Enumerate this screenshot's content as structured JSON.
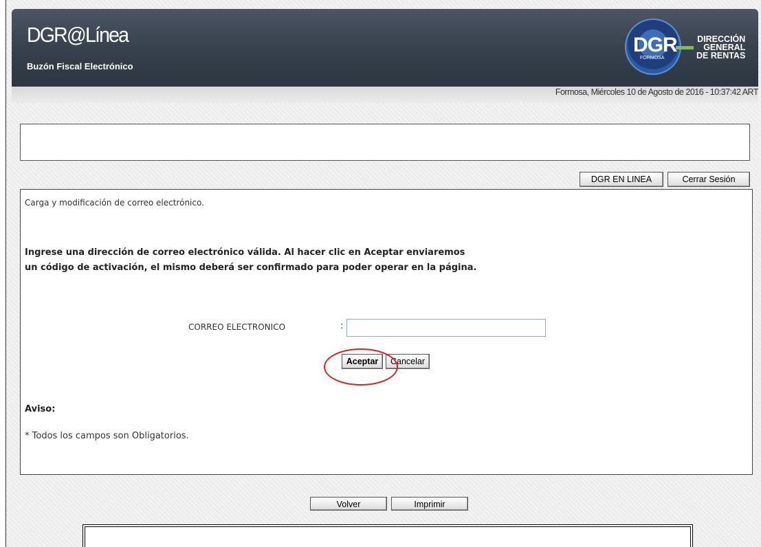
{
  "header": {
    "app_title": "DGR@Línea",
    "subtitle": "Buzón Fiscal Electrónico",
    "logo": {
      "badge": "DGR",
      "region": "FORMOSA",
      "line1": "DIRECCIÓN",
      "line2": "GENERAL",
      "line3": "DE RENTAS"
    }
  },
  "datebar": {
    "text": "Formosa, Miércoles 10 de Agosto de 2016 - 10:37:42 ART"
  },
  "toolbar": {
    "dgr_label": "DGR EN LINEA",
    "logout_label": "Cerrar Sesión"
  },
  "panel": {
    "title": "Carga y modificación de correo electrónico.",
    "instructions_line1": "Ingrese una dirección de correo electrónico válida. Al hacer clic en Aceptar enviaremos",
    "instructions_line2": "un código de activación, el mismo deberá ser confirmado para poder operar en la página.",
    "field_label": "CORREO ELECTRONICO",
    "field_colon": ":",
    "email_value": "",
    "accept_label": "Aceptar",
    "cancel_label": "Cancelar",
    "notice_title": "Aviso:",
    "notice_text": "* Todos los campos son Obligatorios."
  },
  "footer": {
    "back_label": "Volver",
    "print_label": "Imprimir"
  },
  "colors": {
    "header": "#35404c",
    "highlight": "#e02020",
    "input_border": "#8aa8d0"
  }
}
